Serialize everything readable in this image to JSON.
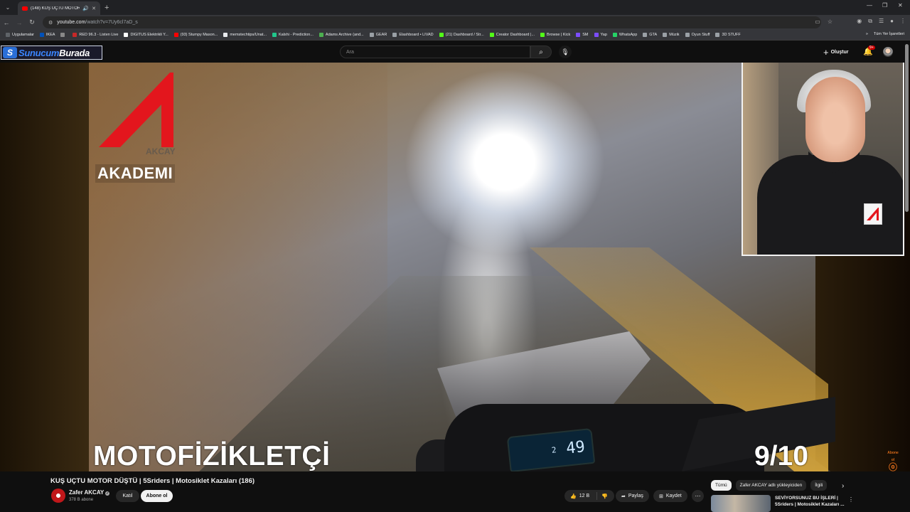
{
  "browser": {
    "tab_title": "(148) KUŞ UÇTU MOTOR D",
    "url_host": "youtube.com",
    "url_path": "/watch?v=7Uy6cl7aD_s",
    "bookmarks": [
      {
        "label": "Uygulamalar",
        "color": "#5f6368"
      },
      {
        "label": "IKEA",
        "color": "#0051ba"
      },
      {
        "label": "",
        "color": "#888888"
      },
      {
        "label": "RED 96.3 - Listen Live",
        "color": "#c62828"
      },
      {
        "label": "DIGITUS Elektrikli Y...",
        "color": "#ffffff"
      },
      {
        "label": "(93) Stumpy Mason...",
        "color": "#ff0000"
      },
      {
        "label": "memstechtips/Unat...",
        "color": "#e8eaed"
      },
      {
        "label": "Kalshi - Prediction...",
        "color": "#21c68b"
      },
      {
        "label": "Adams Archive (and...",
        "color": "#4caf50"
      },
      {
        "label": "GEAR",
        "color": "#9aa0a6"
      },
      {
        "label": "Elashboard • LIVAD",
        "color": "#9aa0a6"
      },
      {
        "label": "(21) Dashboard / Str...",
        "color": "#53fc18"
      },
      {
        "label": "Creator Dashboard |...",
        "color": "#53fc18"
      },
      {
        "label": "Browse | Kick",
        "color": "#53fc18"
      },
      {
        "label": "SM",
        "color": "#7c4dff"
      },
      {
        "label": "Yap",
        "color": "#7c4dff"
      },
      {
        "label": "WhatsApp",
        "color": "#25d366"
      },
      {
        "label": "GTA",
        "color": "#9aa0a6"
      },
      {
        "label": "Müzik",
        "color": "#9aa0a6"
      },
      {
        "label": "Oyun Stuff",
        "color": "#9aa0a6"
      },
      {
        "label": "3D STUFF",
        "color": "#9aa0a6"
      }
    ],
    "bookmarks_all": "Tüm Yer İşaretleri"
  },
  "header": {
    "brand_prefix": "Sunucum",
    "brand_suffix": "Burada",
    "search_placeholder": "Ara",
    "create_label": "Oluştur",
    "notif_count": "9+"
  },
  "video": {
    "overlay_logo_text": "AKADEMI",
    "overlay_logo_sub": "AKCAY",
    "caption_left": "MOTOFİZİKLETÇİ",
    "caption_right": "9/10",
    "speed": "49",
    "gear": "2",
    "subscribe_watermark": "Abone ol",
    "accent_red": "#e3161d"
  },
  "meta": {
    "title": "KUŞ UÇTU MOTOR DÜŞTÜ | 5Sriders | Motosiklet Kazaları (186)",
    "channel": "Zafer AKCAY",
    "subscribers": "378 B abone",
    "join_label": "Katıl",
    "subscribe_label": "Abone ol",
    "likes": "12 B",
    "share_label": "Paylaş",
    "save_label": "Kaydet"
  },
  "sidebar": {
    "chips": [
      "Tümü",
      "Zafer AKCAY adlı yükleyiciden",
      "İlgili"
    ],
    "rec_title": "SEVİYORSUNUZ BU İŞLERİ | 5Sriders | Motosiklet Kazaları ..."
  }
}
